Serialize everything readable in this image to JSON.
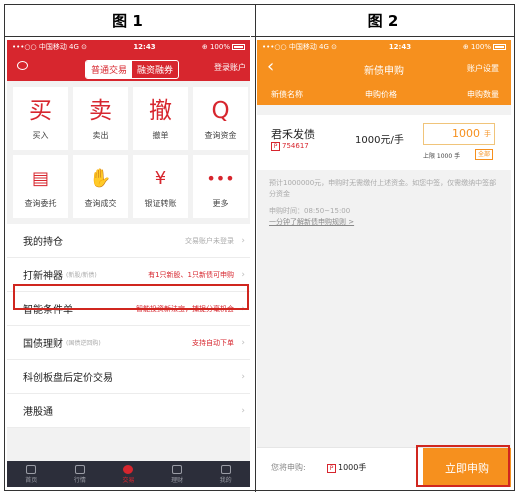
{
  "figure_titles": [
    "图 1",
    "图 2"
  ],
  "fig1": {
    "status": {
      "carrier": "•••○○ 中国移动  4G ⊙",
      "time": "12:43",
      "battery": "⊕ 100%"
    },
    "nav": {
      "tabs": [
        "普通交易",
        "融资融券"
      ],
      "login": "登录账户"
    },
    "actions": [
      {
        "glyph": "买",
        "label": "买入"
      },
      {
        "glyph": "卖",
        "label": "卖出"
      },
      {
        "glyph": "撤",
        "label": "撤单"
      },
      {
        "glyph": "Q",
        "label": "查询资金"
      },
      {
        "glyph": "▤",
        "label": "查询委托"
      },
      {
        "glyph": "✋",
        "label": "查询成交"
      },
      {
        "glyph": "¥",
        "label": "银证转账"
      },
      {
        "glyph": "•••",
        "label": "更多"
      }
    ],
    "list": [
      {
        "name": "我的持仓",
        "sub": "",
        "right": "交易账户未登录",
        "accent": false
      },
      {
        "name": "打新神器",
        "sub": "(新股/新债)",
        "right": "有1只新股、1只新债可申购",
        "accent": true
      },
      {
        "name": "智能条件单",
        "sub": "",
        "right": "智能投资新法宝，捕捉分毫机会",
        "accent": true
      },
      {
        "name": "国债理财",
        "sub": "(国债逆回购)",
        "right": "支持自动下单",
        "accent": true
      },
      {
        "name": "科创板盘后定价交易",
        "sub": "",
        "right": "",
        "accent": false
      },
      {
        "name": "港股通",
        "sub": "",
        "right": "",
        "accent": false
      }
    ],
    "tabbar": [
      "首页",
      "行情",
      "交易",
      "理财",
      "我的"
    ]
  },
  "fig2": {
    "status": {
      "carrier": "•••○○ 中国移动  4G ⊙",
      "time": "12:43",
      "battery": "⊕ 100%"
    },
    "title": "新债申购",
    "account": "账户设置",
    "columns": [
      "新债名称",
      "申购价格",
      "申购数量"
    ],
    "bond": {
      "name": "君禾发债",
      "code_prefix": "P",
      "code": "754617",
      "price": "1000元/手",
      "qty": "1000",
      "qty_unit": "手",
      "limit": "上限 1000 手",
      "all": "全部"
    },
    "note": "预计1000000元，申购时无需缴付上述资金。如您中签，仅需缴纳中签部分资金",
    "time": "申购时间：08:50~15:00",
    "link": "一分钟了解新债申购规则 >",
    "bottom": {
      "will": "您将申购:",
      "qty": "1000手",
      "button": "立即申购"
    }
  }
}
